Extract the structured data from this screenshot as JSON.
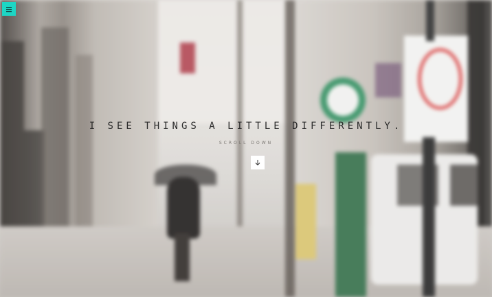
{
  "hero": {
    "tagline": "I SEE THINGS A LITTLE DIFFERENTLY.",
    "scroll_label": "SCROLL DOWN"
  },
  "icons": {
    "menu": "hamburger-menu-icon",
    "scroll": "arrow-down-icon"
  },
  "colors": {
    "accent": "#1dd6c4",
    "tagline": "#2b2b2b",
    "scroll_label": "#7a7672"
  }
}
